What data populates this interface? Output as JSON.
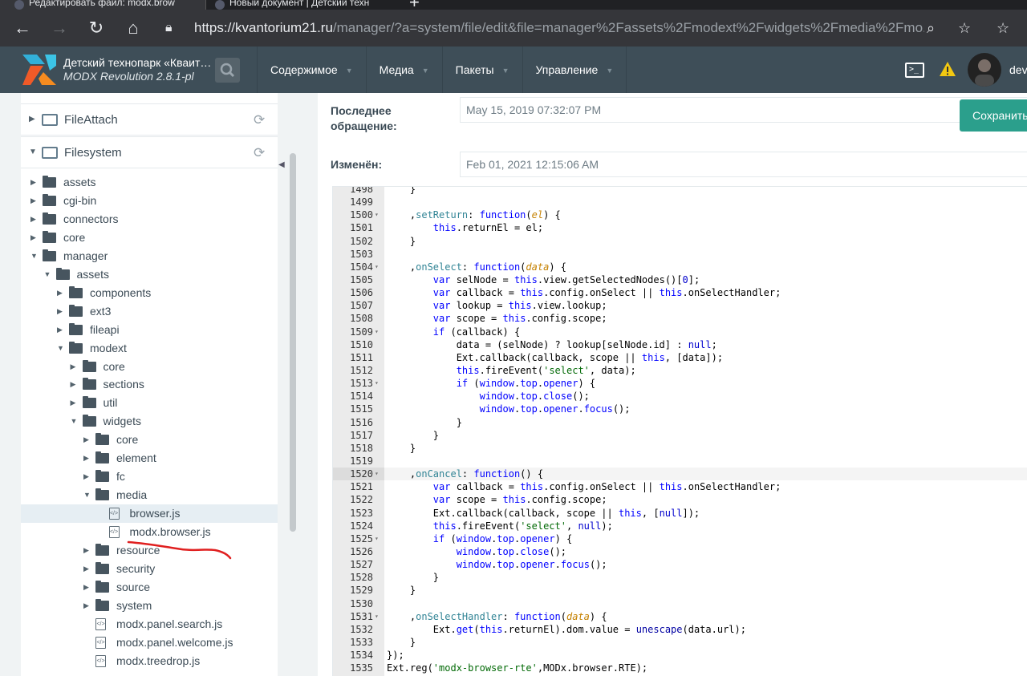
{
  "browser": {
    "tabs": [
      {
        "title": "Редактировать файл: modx.brow"
      },
      {
        "title": "Новый документ | Детский техн"
      }
    ],
    "url_host": "https://kvantorium21.ru",
    "url_path": "/manager/?a=system/file/edit&file=manager%2Fassets%2Fmodext%2Fwidgets%2Fmedia%2Fmo..."
  },
  "header": {
    "site_name": "Детский технопарк «Кваит…",
    "version": "MODX Revolution 2.8.1-pl",
    "nav": [
      "Содержимое",
      "Медиа",
      "Пакеты",
      "Управление"
    ],
    "user": "dev"
  },
  "tree": {
    "sections": [
      {
        "label": "FileAttach",
        "expanded": false
      },
      {
        "label": "Filesystem",
        "expanded": true
      }
    ],
    "items": [
      {
        "label": "assets",
        "type": "folder",
        "depth": 0,
        "arrow": "▶"
      },
      {
        "label": "cgi-bin",
        "type": "folder",
        "depth": 0,
        "arrow": "▶"
      },
      {
        "label": "connectors",
        "type": "folder",
        "depth": 0,
        "arrow": "▶"
      },
      {
        "label": "core",
        "type": "folder",
        "depth": 0,
        "arrow": "▶"
      },
      {
        "label": "manager",
        "type": "folder",
        "depth": 0,
        "arrow": "▼"
      },
      {
        "label": "assets",
        "type": "folder",
        "depth": 1,
        "arrow": "▼"
      },
      {
        "label": "components",
        "type": "folder",
        "depth": 2,
        "arrow": "▶"
      },
      {
        "label": "ext3",
        "type": "folder",
        "depth": 2,
        "arrow": "▶"
      },
      {
        "label": "fileapi",
        "type": "folder",
        "depth": 2,
        "arrow": "▶"
      },
      {
        "label": "modext",
        "type": "folder",
        "depth": 2,
        "arrow": "▼"
      },
      {
        "label": "core",
        "type": "folder",
        "depth": 3,
        "arrow": "▶"
      },
      {
        "label": "sections",
        "type": "folder",
        "depth": 3,
        "arrow": "▶"
      },
      {
        "label": "util",
        "type": "folder",
        "depth": 3,
        "arrow": "▶"
      },
      {
        "label": "widgets",
        "type": "folder",
        "depth": 3,
        "arrow": "▼"
      },
      {
        "label": "core",
        "type": "folder",
        "depth": 4,
        "arrow": "▶"
      },
      {
        "label": "element",
        "type": "folder",
        "depth": 4,
        "arrow": "▶"
      },
      {
        "label": "fc",
        "type": "folder",
        "depth": 4,
        "arrow": "▶"
      },
      {
        "label": "media",
        "type": "folder",
        "depth": 4,
        "arrow": "▼"
      },
      {
        "label": "browser.js",
        "type": "file",
        "depth": 5,
        "arrow": "",
        "selected": true
      },
      {
        "label": "modx.browser.js",
        "type": "file",
        "depth": 5,
        "arrow": ""
      },
      {
        "label": "resource",
        "type": "folder",
        "depth": 4,
        "arrow": "▶"
      },
      {
        "label": "security",
        "type": "folder",
        "depth": 4,
        "arrow": "▶"
      },
      {
        "label": "source",
        "type": "folder",
        "depth": 4,
        "arrow": "▶"
      },
      {
        "label": "system",
        "type": "folder",
        "depth": 4,
        "arrow": "▶"
      },
      {
        "label": "modx.panel.search.js",
        "type": "file",
        "depth": 4,
        "arrow": ""
      },
      {
        "label": "modx.panel.welcome.js",
        "type": "file",
        "depth": 4,
        "arrow": ""
      },
      {
        "label": "modx.treedrop.js",
        "type": "file",
        "depth": 4,
        "arrow": ""
      }
    ]
  },
  "fields": {
    "last_access_label": "Последнее обращение:",
    "last_access_value": "May 15, 2019 07:32:07 PM",
    "modified_label": "Изменён:",
    "modified_value": "Feb 01, 2021 12:15:06 AM"
  },
  "save_label": "Сохранить",
  "code": [
    {
      "n": "1498",
      "fold": "",
      "t": [
        [
          "",
          "    }"
        ]
      ]
    },
    {
      "n": "1499",
      "fold": "",
      "t": [
        [
          "",
          ""
        ]
      ]
    },
    {
      "n": "1500",
      "fold": "▾",
      "t": [
        [
          "",
          "    ,"
        ],
        [
          "id",
          "setReturn"
        ],
        [
          "",
          ": "
        ],
        [
          "k",
          "function"
        ],
        [
          "",
          "("
        ],
        [
          "p",
          "el"
        ],
        [
          "",
          ") {"
        ]
      ]
    },
    {
      "n": "1501",
      "fold": "",
      "t": [
        [
          "",
          "        "
        ],
        [
          "k",
          "this"
        ],
        [
          "",
          ".returnEl = el;"
        ]
      ]
    },
    {
      "n": "1502",
      "fold": "",
      "t": [
        [
          "",
          "    }"
        ]
      ]
    },
    {
      "n": "1503",
      "fold": "",
      "t": [
        [
          "",
          ""
        ]
      ]
    },
    {
      "n": "1504",
      "fold": "▾",
      "t": [
        [
          "",
          "    ,"
        ],
        [
          "id",
          "onSelect"
        ],
        [
          "",
          ": "
        ],
        [
          "k",
          "function"
        ],
        [
          "",
          "("
        ],
        [
          "p",
          "data"
        ],
        [
          "",
          ") {"
        ]
      ]
    },
    {
      "n": "1505",
      "fold": "",
      "t": [
        [
          "",
          "        "
        ],
        [
          "k",
          "var"
        ],
        [
          "",
          " selNode = "
        ],
        [
          "k",
          "this"
        ],
        [
          "",
          ".view.getSelectedNodes()["
        ],
        [
          "n",
          "0"
        ],
        [
          "",
          "];"
        ]
      ]
    },
    {
      "n": "1506",
      "fold": "",
      "t": [
        [
          "",
          "        "
        ],
        [
          "k",
          "var"
        ],
        [
          "",
          " callback = "
        ],
        [
          "k",
          "this"
        ],
        [
          "",
          ".config.onSelect || "
        ],
        [
          "k",
          "this"
        ],
        [
          "",
          ".onSelectHandler;"
        ]
      ]
    },
    {
      "n": "1507",
      "fold": "",
      "t": [
        [
          "",
          "        "
        ],
        [
          "k",
          "var"
        ],
        [
          "",
          " lookup = "
        ],
        [
          "k",
          "this"
        ],
        [
          "",
          ".view.lookup;"
        ]
      ]
    },
    {
      "n": "1508",
      "fold": "",
      "t": [
        [
          "",
          "        "
        ],
        [
          "k",
          "var"
        ],
        [
          "",
          " scope = "
        ],
        [
          "k",
          "this"
        ],
        [
          "",
          ".config.scope;"
        ]
      ]
    },
    {
      "n": "1509",
      "fold": "▾",
      "t": [
        [
          "",
          "        "
        ],
        [
          "k",
          "if"
        ],
        [
          "",
          " (callback) {"
        ]
      ]
    },
    {
      "n": "1510",
      "fold": "",
      "t": [
        [
          "",
          "            data = (selNode) ? lookup[selNode.id] : "
        ],
        [
          "n",
          "null"
        ],
        [
          "",
          ";"
        ]
      ]
    },
    {
      "n": "1511",
      "fold": "",
      "t": [
        [
          "",
          "            Ext.callback(callback, scope || "
        ],
        [
          "k",
          "this"
        ],
        [
          "",
          ", [data]);"
        ]
      ]
    },
    {
      "n": "1512",
      "fold": "",
      "t": [
        [
          "",
          "            "
        ],
        [
          "k",
          "this"
        ],
        [
          "",
          ".fireEvent("
        ],
        [
          "str",
          "'select'"
        ],
        [
          "",
          ", data);"
        ]
      ]
    },
    {
      "n": "1513",
      "fold": "▾",
      "t": [
        [
          "",
          "            "
        ],
        [
          "k",
          "if"
        ],
        [
          "",
          " ("
        ],
        [
          "k",
          "window"
        ],
        [
          "",
          "."
        ],
        [
          "k",
          "top"
        ],
        [
          "",
          "."
        ],
        [
          "k",
          "opener"
        ],
        [
          "",
          ") {"
        ]
      ]
    },
    {
      "n": "1514",
      "fold": "",
      "t": [
        [
          "",
          "                "
        ],
        [
          "k",
          "window"
        ],
        [
          "",
          "."
        ],
        [
          "k",
          "top"
        ],
        [
          "",
          "."
        ],
        [
          "k",
          "close"
        ],
        [
          "",
          "();"
        ]
      ]
    },
    {
      "n": "1515",
      "fold": "",
      "t": [
        [
          "",
          "                "
        ],
        [
          "k",
          "window"
        ],
        [
          "",
          "."
        ],
        [
          "k",
          "top"
        ],
        [
          "",
          "."
        ],
        [
          "k",
          "opener"
        ],
        [
          "",
          "."
        ],
        [
          "k",
          "focus"
        ],
        [
          "",
          "();"
        ]
      ]
    },
    {
      "n": "1516",
      "fold": "",
      "t": [
        [
          "",
          "            }"
        ]
      ]
    },
    {
      "n": "1517",
      "fold": "",
      "t": [
        [
          "",
          "        }"
        ]
      ]
    },
    {
      "n": "1518",
      "fold": "",
      "t": [
        [
          "",
          "    }"
        ]
      ]
    },
    {
      "n": "1519",
      "fold": "",
      "t": [
        [
          "",
          ""
        ]
      ]
    },
    {
      "n": "1520",
      "fold": "▾",
      "hl": true,
      "t": [
        [
          "",
          "    ,"
        ],
        [
          "id",
          "onCancel"
        ],
        [
          "",
          ": "
        ],
        [
          "k",
          "function"
        ],
        [
          "",
          "() {"
        ]
      ]
    },
    {
      "n": "1521",
      "fold": "",
      "t": [
        [
          "",
          "        "
        ],
        [
          "k",
          "var"
        ],
        [
          "",
          " callback = "
        ],
        [
          "k",
          "this"
        ],
        [
          "",
          ".config.onSelect || "
        ],
        [
          "k",
          "this"
        ],
        [
          "",
          ".onSelectHandler;"
        ]
      ]
    },
    {
      "n": "1522",
      "fold": "",
      "t": [
        [
          "",
          "        "
        ],
        [
          "k",
          "var"
        ],
        [
          "",
          " scope = "
        ],
        [
          "k",
          "this"
        ],
        [
          "",
          ".config.scope;"
        ]
      ]
    },
    {
      "n": "1523",
      "fold": "",
      "t": [
        [
          "",
          "        Ext.callback(callback, scope || "
        ],
        [
          "k",
          "this"
        ],
        [
          "",
          ", ["
        ],
        [
          "n",
          "null"
        ],
        [
          "",
          "]);"
        ]
      ]
    },
    {
      "n": "1524",
      "fold": "",
      "t": [
        [
          "",
          "        "
        ],
        [
          "k",
          "this"
        ],
        [
          "",
          ".fireEvent("
        ],
        [
          "str",
          "'select'"
        ],
        [
          "",
          ", "
        ],
        [
          "n",
          "null"
        ],
        [
          "",
          ");"
        ]
      ]
    },
    {
      "n": "1525",
      "fold": "▾",
      "t": [
        [
          "",
          "        "
        ],
        [
          "k",
          "if"
        ],
        [
          "",
          " ("
        ],
        [
          "k",
          "window"
        ],
        [
          "",
          "."
        ],
        [
          "k",
          "top"
        ],
        [
          "",
          "."
        ],
        [
          "k",
          "opener"
        ],
        [
          "",
          ") {"
        ]
      ]
    },
    {
      "n": "1526",
      "fold": "",
      "t": [
        [
          "",
          "            "
        ],
        [
          "k",
          "window"
        ],
        [
          "",
          "."
        ],
        [
          "k",
          "top"
        ],
        [
          "",
          "."
        ],
        [
          "k",
          "close"
        ],
        [
          "",
          "();"
        ]
      ]
    },
    {
      "n": "1527",
      "fold": "",
      "t": [
        [
          "",
          "            "
        ],
        [
          "k",
          "window"
        ],
        [
          "",
          "."
        ],
        [
          "k",
          "top"
        ],
        [
          "",
          "."
        ],
        [
          "k",
          "opener"
        ],
        [
          "",
          "."
        ],
        [
          "k",
          "focus"
        ],
        [
          "",
          "();"
        ]
      ]
    },
    {
      "n": "1528",
      "fold": "",
      "t": [
        [
          "",
          "        }"
        ]
      ]
    },
    {
      "n": "1529",
      "fold": "",
      "t": [
        [
          "",
          "    }"
        ]
      ]
    },
    {
      "n": "1530",
      "fold": "",
      "t": [
        [
          "",
          ""
        ]
      ]
    },
    {
      "n": "1531",
      "fold": "▾",
      "t": [
        [
          "",
          "    ,"
        ],
        [
          "id",
          "onSelectHandler"
        ],
        [
          "",
          ": "
        ],
        [
          "k",
          "function"
        ],
        [
          "",
          "("
        ],
        [
          "p",
          "data"
        ],
        [
          "",
          ") {"
        ]
      ]
    },
    {
      "n": "1532",
      "fold": "",
      "t": [
        [
          "",
          "        Ext."
        ],
        [
          "k",
          "get"
        ],
        [
          "",
          "("
        ],
        [
          "k",
          "this"
        ],
        [
          "",
          ".returnEl).dom.value = "
        ],
        [
          "f",
          "unescape"
        ],
        [
          "",
          "(data.url);"
        ]
      ]
    },
    {
      "n": "1533",
      "fold": "",
      "t": [
        [
          "",
          "    }"
        ]
      ]
    },
    {
      "n": "1534",
      "fold": "",
      "t": [
        [
          "",
          "});"
        ]
      ]
    },
    {
      "n": "1535",
      "fold": "",
      "t": [
        [
          "",
          "Ext.reg("
        ],
        [
          "str",
          "'modx-browser-rte'"
        ],
        [
          "",
          ",MODx.browser.RTE);"
        ]
      ]
    }
  ],
  "colors": {
    "header": "#3e4e58",
    "save": "#2b9f8c",
    "annotation": "#e02020"
  }
}
